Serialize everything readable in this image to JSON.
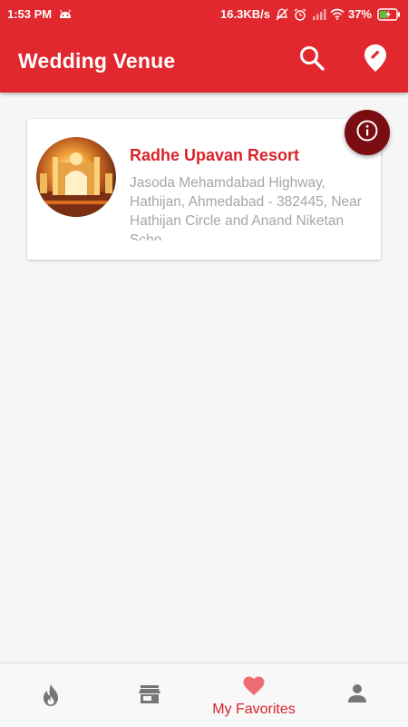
{
  "status_bar": {
    "time": "1:53 PM",
    "net_speed": "16.3KB/s",
    "battery": "37%",
    "icons": [
      "android-icon",
      "mute-icon",
      "alarm-icon",
      "signal-icon",
      "wifi-icon",
      "battery-charging-icon"
    ]
  },
  "app_bar": {
    "title": "Wedding Venue",
    "actions": [
      "search-icon",
      "location-edit-icon"
    ],
    "color": "#e0282e"
  },
  "favorites": [
    {
      "name": "Radhe Upavan Resort",
      "address": "Jasoda Mehamdabad Highway, Hathijan, Ahmedabad - 382445, Near Hathijan Circle and Anand Niketan Scho"
    }
  ],
  "fab": {
    "icon": "info-icon",
    "color": "#7a0d12"
  },
  "bottom_nav": {
    "items": [
      {
        "icon": "flame-icon",
        "label": ""
      },
      {
        "icon": "store-icon",
        "label": ""
      },
      {
        "icon": "heart-icon",
        "label": "My Favorites",
        "active": true
      },
      {
        "icon": "person-icon",
        "label": ""
      }
    ],
    "active_color": "#d8232a"
  }
}
